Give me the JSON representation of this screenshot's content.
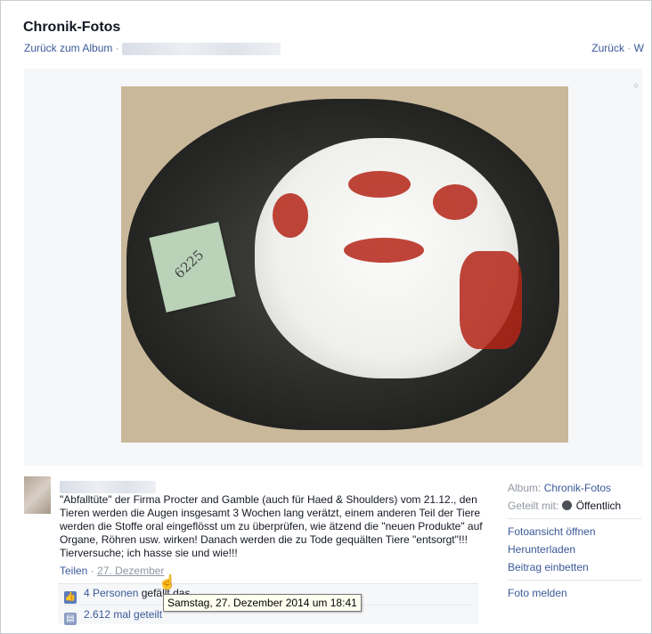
{
  "header": {
    "title": "Chronik-Fotos",
    "back_to_album": "Zurück zum Album",
    "separator": "·",
    "back": "Zurück",
    "next_partial": "W"
  },
  "photo": {
    "tag_label": "6225"
  },
  "post": {
    "text": "\"Abfalltüte\" der Firma Procter and Gamble (auch für Haed & Shoulders) vom 21.12., den Tieren werden die Augen insgesamt 3 Wochen lang verätzt, einem anderen Teil der Tiere werden die Stoffe oral eingeflösst um zu überprüfen, wie ätzend die \"neuen Produkte\" auf Organe, Röhren usw. wirken! Danach werden die zu Tode gequälten Tiere \"entsorgt\"!!! Tierversuche; ich hasse sie und wie!!!",
    "share": "Teilen",
    "dot": "·",
    "date": "27. Dezember",
    "likes": "4 Personen",
    "likes_suffix": "gefällt das.",
    "shares": "2.612 mal geteilt",
    "tooltip": "Samstag, 27. Dezember 2014 um 18:41"
  },
  "sidebar": {
    "album_label": "Album:",
    "album_name": "Chronik-Fotos",
    "shared_with_label": "Geteilt mit:",
    "audience": "Öffentlich",
    "actions": [
      "Fotoansicht öffnen",
      "Herunterladen",
      "Beitrag einbetten"
    ],
    "report": "Foto melden"
  },
  "icons": {
    "like": "thumbs-up-icon",
    "share": "share-icon",
    "audience": "globe-icon",
    "cursor": "hand-cursor-icon"
  },
  "colors": {
    "link": "#3b5998",
    "muted": "#9197a3",
    "stage": "#f6f7f9"
  }
}
